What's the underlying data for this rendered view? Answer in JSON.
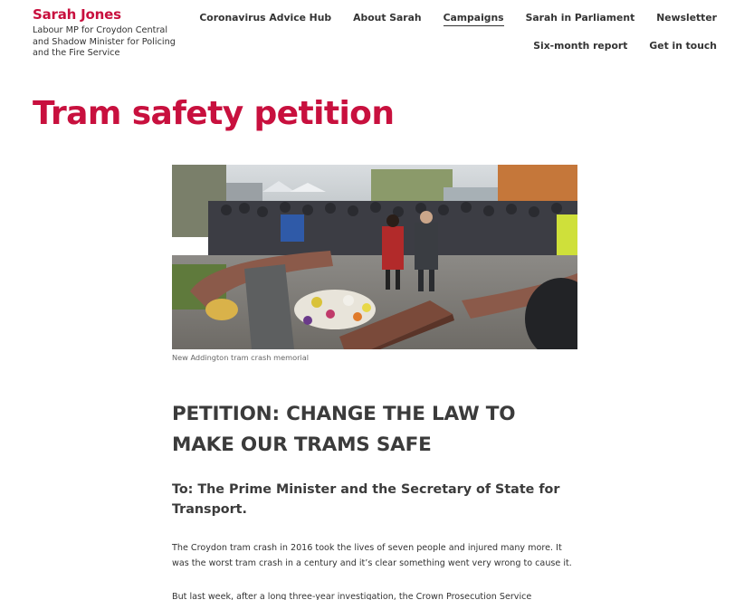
{
  "site": {
    "title": "Sarah Jones",
    "description": "Labour MP for Croydon Central and Shadow Minister for Policing and the Fire Service"
  },
  "nav": {
    "row1": [
      {
        "label": "Coronavirus Advice Hub",
        "active": false
      },
      {
        "label": "About Sarah",
        "active": false
      },
      {
        "label": "Campaigns",
        "active": true
      },
      {
        "label": "Sarah in Parliament",
        "active": false
      },
      {
        "label": "Newsletter",
        "active": false
      }
    ],
    "row2": [
      {
        "label": "Six-month report",
        "active": false
      },
      {
        "label": "Get in touch",
        "active": false
      }
    ]
  },
  "page": {
    "title": "Tram safety petition"
  },
  "figure": {
    "caption": "New Addington tram crash memorial"
  },
  "article": {
    "headline": "PETITION: CHANGE THE LAW TO MAKE OUR TRAMS SAFE",
    "subhead": "To: The Prime Minister and the Secretary of State for Transport.",
    "paragraphs": [
      "The Croydon tram crash in 2016 took the lives of seven people and injured many more. It was the worst tram crash in a century and it’s clear something went very wrong to cause it.",
      "But last week, after a long three-year investigation, the Crown Prosecution Service"
    ]
  },
  "colors": {
    "brand": "#c8103e",
    "text": "#333333"
  }
}
